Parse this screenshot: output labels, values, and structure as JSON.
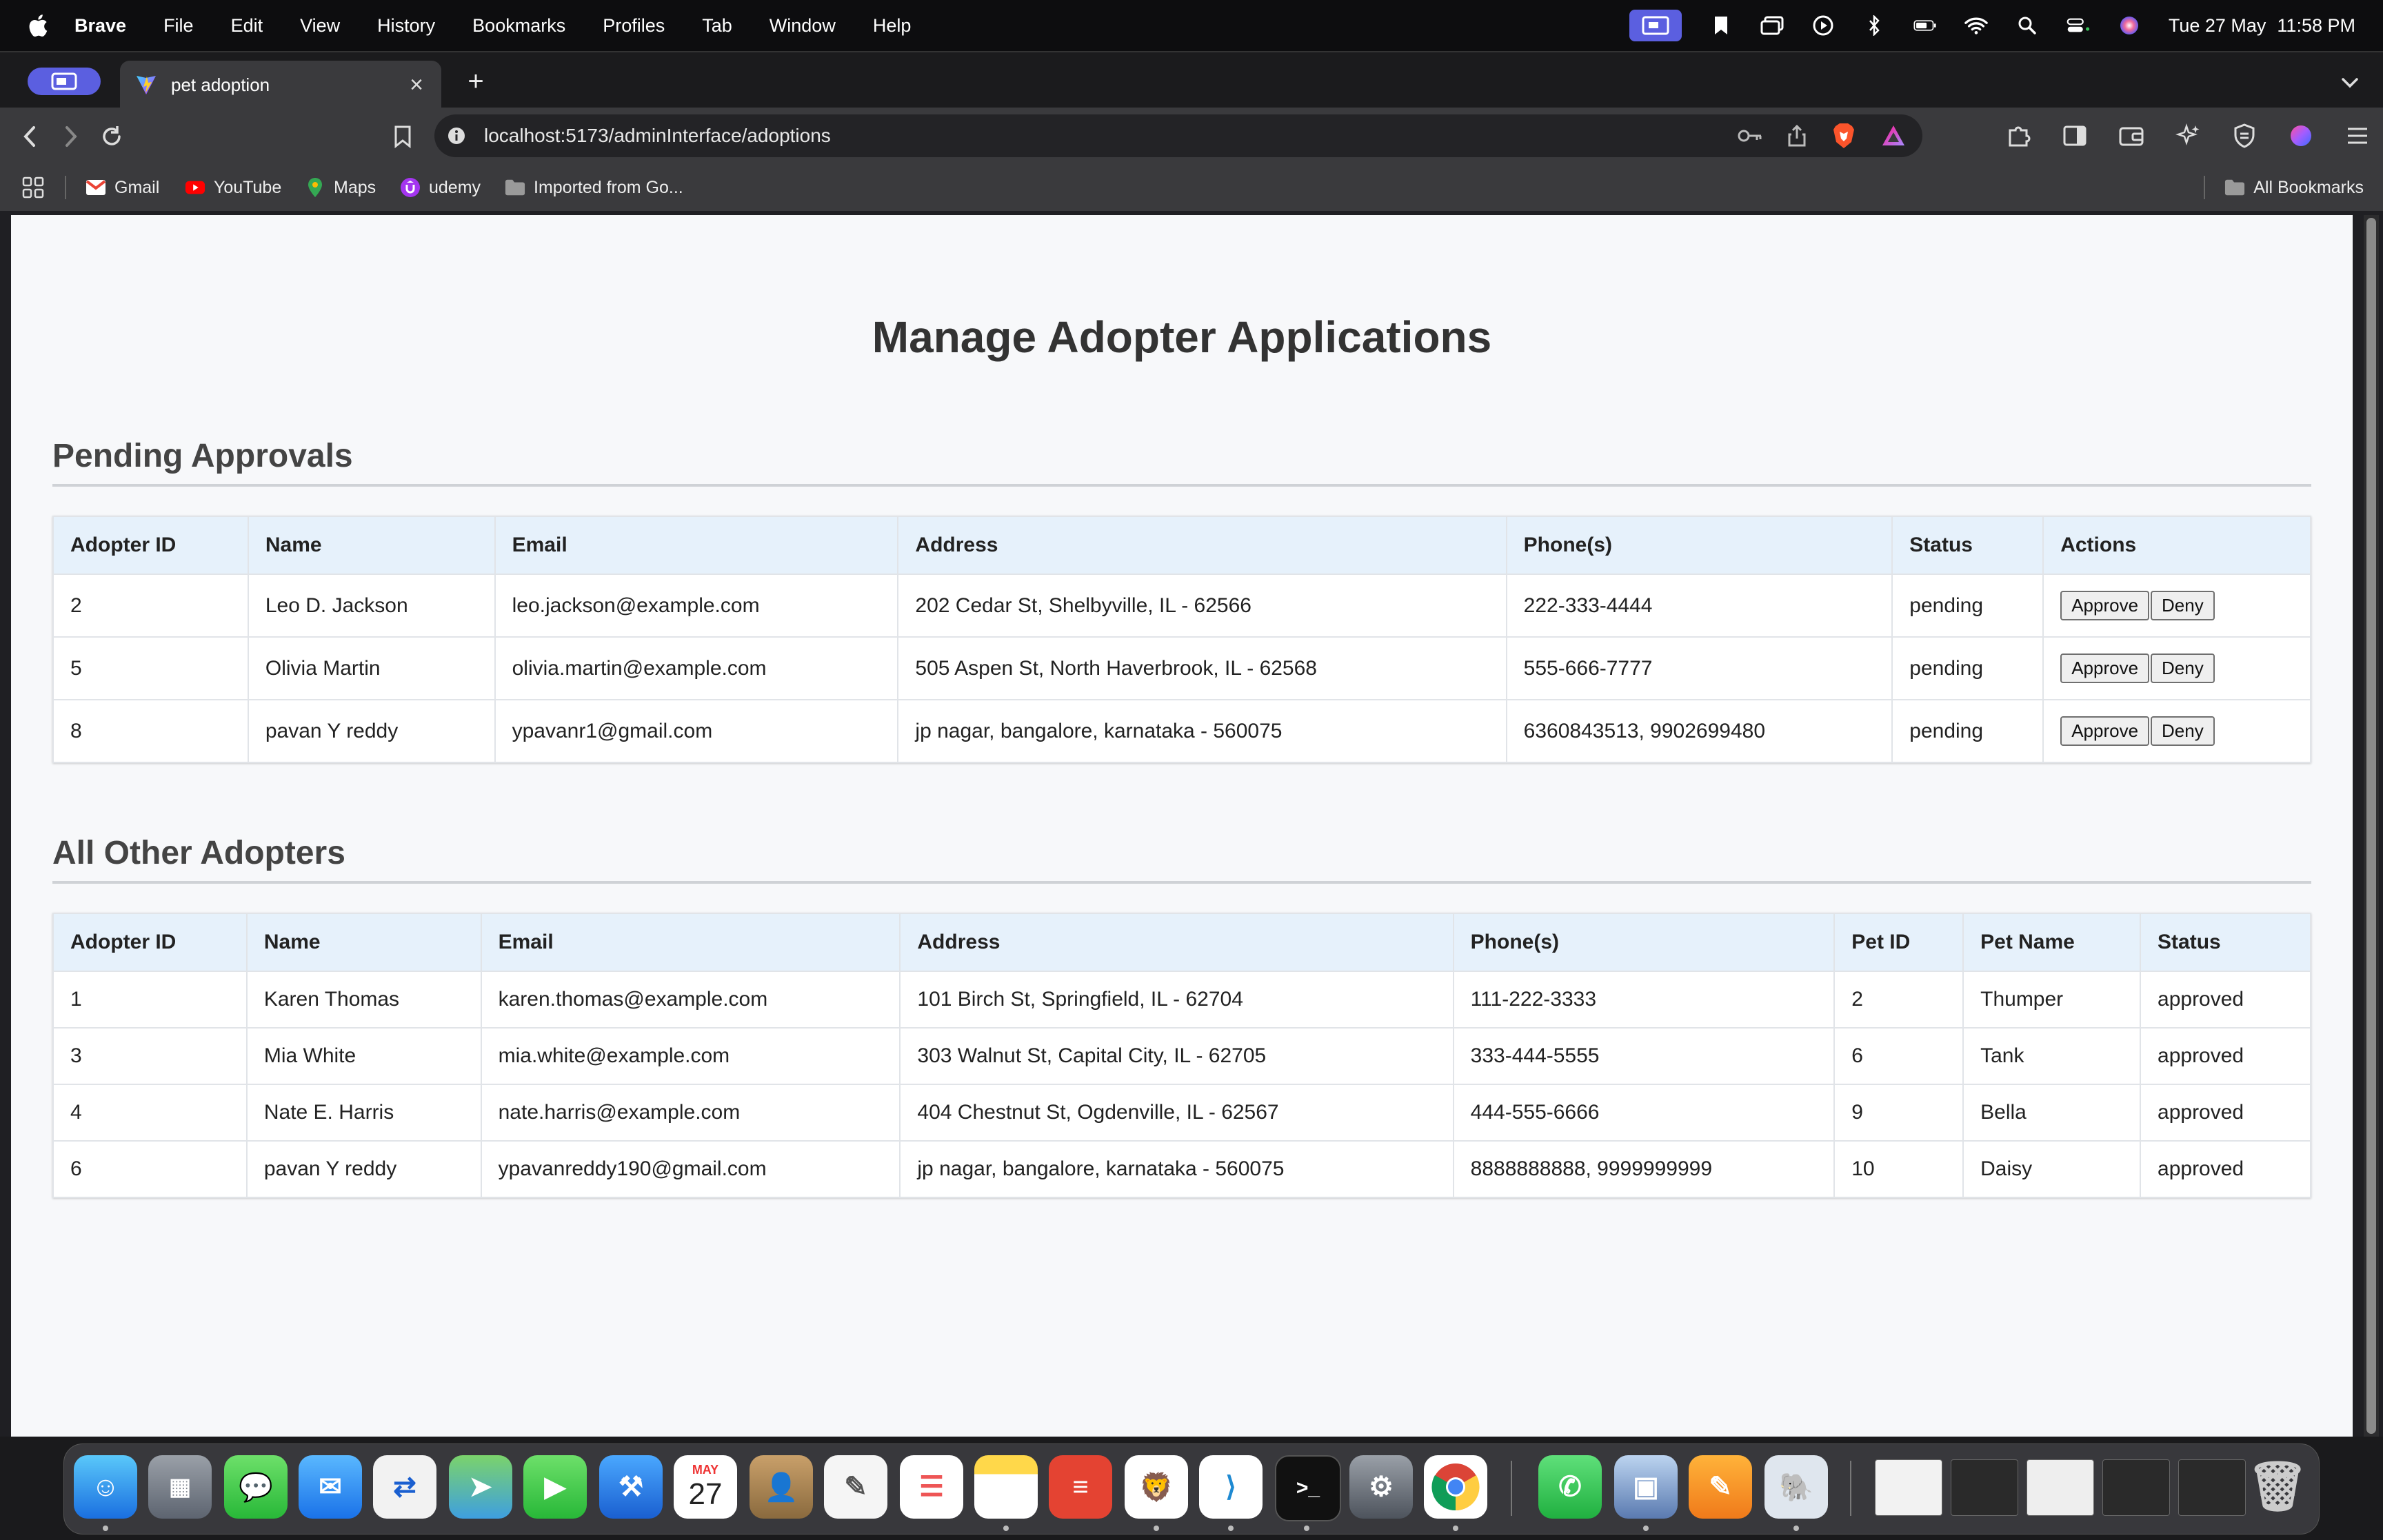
{
  "menubar": {
    "app_name": "Brave",
    "items": [
      "File",
      "Edit",
      "View",
      "History",
      "Bookmarks",
      "Profiles",
      "Tab",
      "Window",
      "Help"
    ],
    "date": "Tue 27 May",
    "time": "11:58 PM"
  },
  "browser": {
    "tab_title": "pet adoption",
    "url": "localhost:5173/adminInterface/adoptions",
    "bookmarks": [
      "Gmail",
      "YouTube",
      "Maps",
      "udemy",
      "Imported from Go..."
    ],
    "all_bookmarks": "All Bookmarks"
  },
  "page": {
    "title": "Manage Adopter Applications",
    "pending": {
      "heading": "Pending Approvals",
      "columns": [
        "Adopter ID",
        "Name",
        "Email",
        "Address",
        "Phone(s)",
        "Status",
        "Actions"
      ],
      "approve_label": "Approve",
      "deny_label": "Deny",
      "rows": [
        {
          "id": "2",
          "name": "Leo D. Jackson",
          "email": "leo.jackson@example.com",
          "address": "202 Cedar St, Shelbyville, IL - 62566",
          "phones": "222-333-4444",
          "status": "pending"
        },
        {
          "id": "5",
          "name": "Olivia Martin",
          "email": "olivia.martin@example.com",
          "address": "505 Aspen St, North Haverbrook, IL - 62568",
          "phones": "555-666-7777",
          "status": "pending"
        },
        {
          "id": "8",
          "name": "pavan Y reddy",
          "email": "ypavanr1@gmail.com",
          "address": "jp nagar, bangalore, karnataka - 560075",
          "phones": "6360843513, 9902699480",
          "status": "pending"
        }
      ]
    },
    "others": {
      "heading": "All Other Adopters",
      "columns": [
        "Adopter ID",
        "Name",
        "Email",
        "Address",
        "Phone(s)",
        "Pet ID",
        "Pet Name",
        "Status"
      ],
      "rows": [
        {
          "id": "1",
          "name": "Karen Thomas",
          "email": "karen.thomas@example.com",
          "address": "101 Birch St, Springfield, IL - 62704",
          "phones": "111-222-3333",
          "pet_id": "2",
          "pet_name": "Thumper",
          "status": "approved"
        },
        {
          "id": "3",
          "name": "Mia White",
          "email": "mia.white@example.com",
          "address": "303 Walnut St, Capital City, IL - 62705",
          "phones": "333-444-5555",
          "pet_id": "6",
          "pet_name": "Tank",
          "status": "approved"
        },
        {
          "id": "4",
          "name": "Nate E. Harris",
          "email": "nate.harris@example.com",
          "address": "404 Chestnut St, Ogdenville, IL - 62567",
          "phones": "444-555-6666",
          "pet_id": "9",
          "pet_name": "Bella",
          "status": "approved"
        },
        {
          "id": "6",
          "name": "pavan Y reddy",
          "email": "ypavanreddy190@gmail.com",
          "address": "jp nagar, bangalore, karnataka - 560075",
          "phones": "8888888888, 9999999999",
          "pet_id": "10",
          "pet_name": "Daisy",
          "status": "approved"
        }
      ]
    }
  },
  "dock": {
    "calendar_month": "MAY",
    "calendar_day": "27"
  },
  "colors": {
    "table_header_bg": "#e6f1fb",
    "page_bg": "#f7f8fa",
    "brand_accent": "#5b5fe0"
  }
}
